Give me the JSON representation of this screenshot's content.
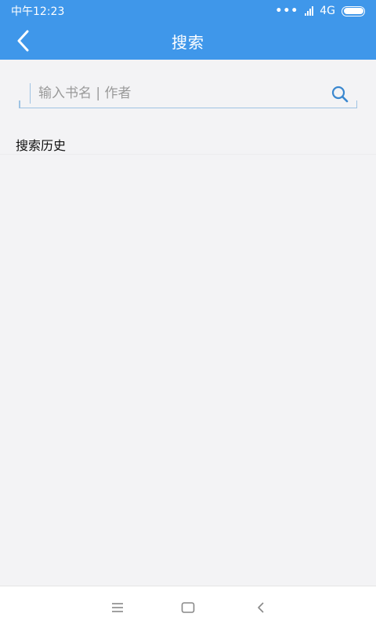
{
  "status_bar": {
    "time": "中午12:23",
    "network": "4G"
  },
  "header": {
    "title": "搜索"
  },
  "search": {
    "placeholder": "输入书名 | 作者",
    "value": ""
  },
  "history": {
    "title": "搜索历史",
    "items": []
  },
  "icons": {
    "back": "chevron-left-icon",
    "search": "search-icon",
    "menu": "menu-icon",
    "home": "home-icon",
    "system_back": "back-icon"
  },
  "colors": {
    "accent": "#3f97ea",
    "background": "#f3f3f5",
    "search_line": "#9fc3e3"
  }
}
